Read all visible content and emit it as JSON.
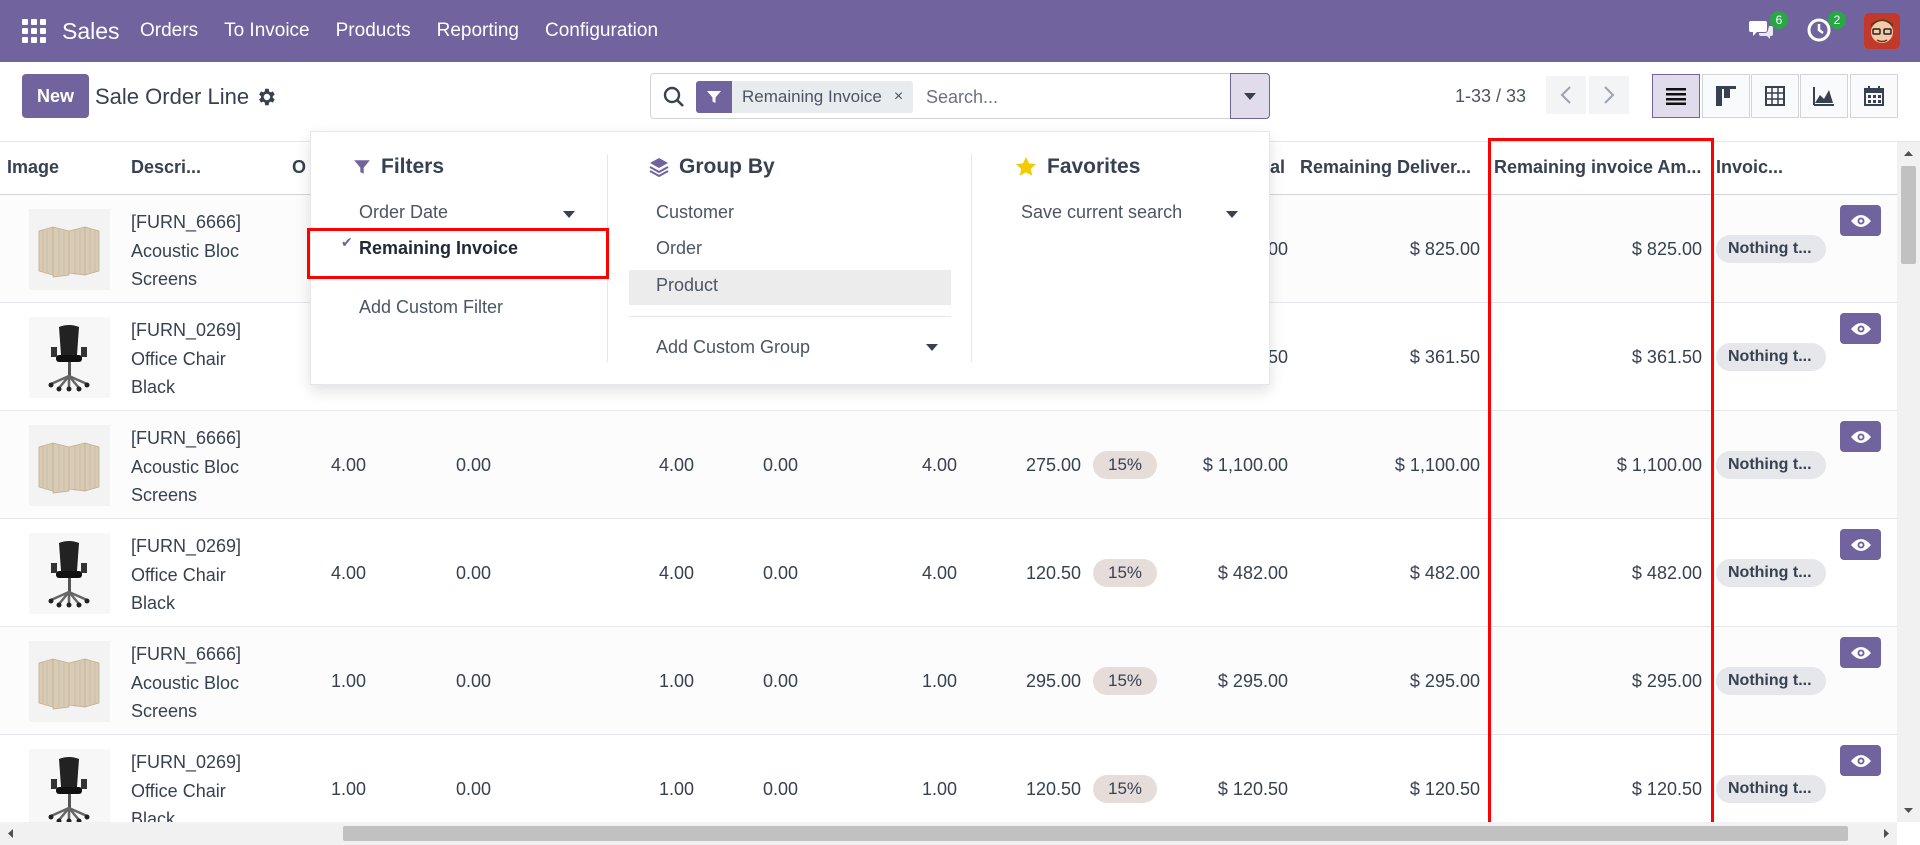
{
  "navbar": {
    "app_name": "Sales",
    "menu": [
      "Orders",
      "To Invoice",
      "Products",
      "Reporting",
      "Configuration"
    ],
    "messages_count": "6",
    "activities_count": "2",
    "accent": "#71639e"
  },
  "control_panel": {
    "new_label": "New",
    "title": "Sale Order Line",
    "facet_label": "Remaining Invoice",
    "facet_close": "×",
    "search_placeholder": "Search...",
    "pager": "1-33 / 33"
  },
  "dropdown": {
    "filters": {
      "title": "Filters",
      "items": [
        "Order Date",
        "Remaining Invoice",
        "Add Custom Filter"
      ],
      "check": "✔"
    },
    "group_by": {
      "title": "Group By",
      "items": [
        "Customer",
        "Order",
        "Product",
        "Add Custom Group"
      ]
    },
    "favorites": {
      "title": "Favorites",
      "items": [
        "Save current search"
      ]
    }
  },
  "table": {
    "headers": {
      "image": "Image",
      "description": "Descri...",
      "ordered": "O",
      "total": "cal",
      "remaining_delivery": "Remaining Deliver...",
      "remaining_invoice": "Remaining invoice Am...",
      "invoice_status": "Invoic..."
    },
    "rows": [
      {
        "ref": "[FURN_6666]",
        "name1": "Acoustic Bloc",
        "name2": "Screens",
        "type": "screen",
        "qty": "",
        "delivered": "",
        "invoiced_qty": "",
        "to_invoice": "",
        "remaining_qty": "",
        "price": "",
        "discount": "",
        "total": "00",
        "remaining_delivery": "$ 825.00",
        "remaining_invoice": "$ 825.00",
        "status": "Nothing t..."
      },
      {
        "ref": "[FURN_0269]",
        "name1": "Office Chair",
        "name2": "Black",
        "type": "chair",
        "qty": "",
        "delivered": "",
        "invoiced_qty": "",
        "to_invoice": "",
        "remaining_qty": "",
        "price": "",
        "discount": "",
        "total": "50",
        "remaining_delivery": "$ 361.50",
        "remaining_invoice": "$ 361.50",
        "status": "Nothing t..."
      },
      {
        "ref": "[FURN_6666]",
        "name1": "Acoustic Bloc",
        "name2": "Screens",
        "type": "screen",
        "qty": "4.00",
        "delivered": "0.00",
        "invoiced_qty": "4.00",
        "to_invoice": "0.00",
        "remaining_qty": "4.00",
        "price": "275.00",
        "discount": "15%",
        "total": "$ 1,100.00",
        "remaining_delivery": "$ 1,100.00",
        "remaining_invoice": "$ 1,100.00",
        "status": "Nothing t..."
      },
      {
        "ref": "[FURN_0269]",
        "name1": "Office Chair",
        "name2": "Black",
        "type": "chair",
        "qty": "4.00",
        "delivered": "0.00",
        "invoiced_qty": "4.00",
        "to_invoice": "0.00",
        "remaining_qty": "4.00",
        "price": "120.50",
        "discount": "15%",
        "total": "$ 482.00",
        "remaining_delivery": "$ 482.00",
        "remaining_invoice": "$ 482.00",
        "status": "Nothing t..."
      },
      {
        "ref": "[FURN_6666]",
        "name1": "Acoustic Bloc",
        "name2": "Screens",
        "type": "screen",
        "qty": "1.00",
        "delivered": "0.00",
        "invoiced_qty": "1.00",
        "to_invoice": "0.00",
        "remaining_qty": "1.00",
        "price": "295.00",
        "discount": "15%",
        "total": "$ 295.00",
        "remaining_delivery": "$ 295.00",
        "remaining_invoice": "$ 295.00",
        "status": "Nothing t..."
      },
      {
        "ref": "[FURN_0269]",
        "name1": "Office Chair",
        "name2": "Black",
        "type": "chair",
        "qty": "1.00",
        "delivered": "0.00",
        "invoiced_qty": "1.00",
        "to_invoice": "0.00",
        "remaining_qty": "1.00",
        "price": "120.50",
        "discount": "15%",
        "total": "$ 120.50",
        "remaining_delivery": "$ 120.50",
        "remaining_invoice": "$ 120.50",
        "status": "Nothing t..."
      }
    ]
  },
  "colors": {
    "highlight": "#ff0000",
    "pill": "#e6dcda"
  },
  "icons": [
    "apps-grid-icon",
    "chat-icon",
    "clock-icon",
    "gear-icon",
    "search-icon",
    "filter-icon",
    "caret-down-icon",
    "chevron-left-icon",
    "chevron-right-icon",
    "list-view-icon",
    "kanban-view-icon",
    "pivot-view-icon",
    "graph-view-icon",
    "calendar-view-icon",
    "layers-icon",
    "star-icon",
    "eye-icon"
  ]
}
